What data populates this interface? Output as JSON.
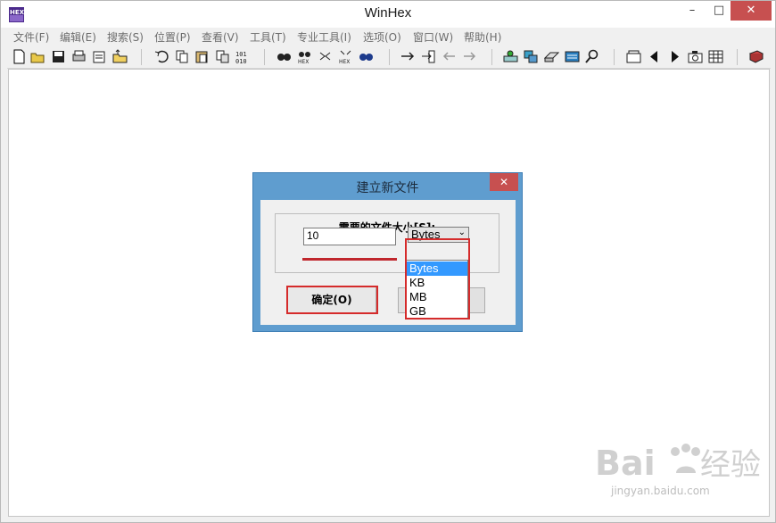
{
  "window": {
    "title": "WinHex"
  },
  "window_controls": {
    "minimize": "–",
    "maximize": "□",
    "close": "✕"
  },
  "menubar": {
    "items": [
      "文件(F)",
      "编辑(E)",
      "搜索(S)",
      "位置(P)",
      "查看(V)",
      "工具(T)",
      "专业工具(I)",
      "选项(O)",
      "窗口(W)",
      "帮助(H)"
    ]
  },
  "toolbar": {
    "icons": [
      "new-file",
      "open-file",
      "save",
      "print",
      "properties",
      "open-folder",
      "undo",
      "copy",
      "paste",
      "paste-special",
      "binary",
      "find",
      "find-hex",
      "replace",
      "replace-hex",
      "find-next",
      "goto",
      "goto-sector",
      "back",
      "forward",
      "disk",
      "ram",
      "drive",
      "calculator",
      "search-icon",
      "sector-view",
      "prev",
      "next",
      "camera",
      "table",
      "book"
    ]
  },
  "dialog": {
    "title": "建立新文件",
    "close": "✕",
    "size_label": "需要的文件大小[S]:",
    "size_value": "10",
    "unit_selected": "Bytes",
    "unit_options": [
      "Bytes",
      "KB",
      "MB",
      "GB"
    ],
    "ok_label": "确定(O)"
  },
  "watermark": {
    "text": "jingyan.baidu.com"
  },
  "colors": {
    "accent_blue": "#5f9dcf",
    "highlight_red": "#d52b2b",
    "selected_option": "#3399ff"
  }
}
